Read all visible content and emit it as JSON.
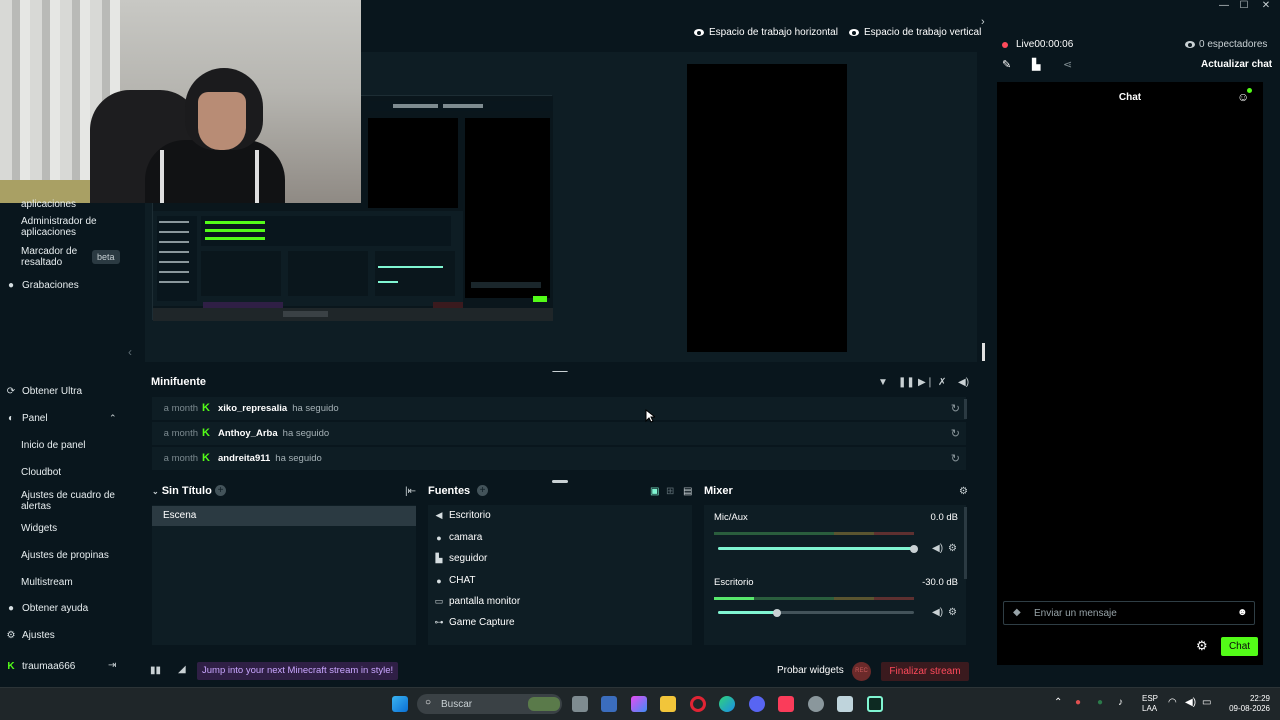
{
  "window": {
    "minimize": "—",
    "maximize": "☐",
    "close": "✕"
  },
  "top": {
    "workspace_h": "Espacio de trabajo horizontal",
    "workspace_v": "Espacio de trabajo vertical"
  },
  "sidebar": {
    "items": [
      {
        "label": "aplicaciones"
      },
      {
        "label": "Administrador de aplicaciones"
      },
      {
        "label": "Marcador de resaltado",
        "badge": "beta"
      },
      {
        "label": "Grabaciones"
      },
      {
        "label": "Obtener Ultra"
      },
      {
        "label": "Panel"
      },
      {
        "label": "Inicio de panel"
      },
      {
        "label": "Cloudbot"
      },
      {
        "label": "Ajustes de cuadro de alertas"
      },
      {
        "label": "Widgets"
      },
      {
        "label": "Ajustes de propinas"
      },
      {
        "label": "Multistream"
      },
      {
        "label": "Obtener ayuda"
      },
      {
        "label": "Ajustes"
      }
    ],
    "user": "traumaa666"
  },
  "minifuente": {
    "title": "Minifuente",
    "events": [
      {
        "time": "a month",
        "user": "xiko_represalia",
        "action": "ha seguido"
      },
      {
        "time": "a month",
        "user": "Anthoy_Arba",
        "action": "ha seguido"
      },
      {
        "time": "a month",
        "user": "andreita911",
        "action": "ha seguido"
      }
    ]
  },
  "scenes": {
    "title": "Sin Título",
    "items": [
      "Escena"
    ]
  },
  "sources": {
    "title": "Fuentes",
    "items": [
      {
        "label": "Escritorio",
        "icon": "speaker-icon"
      },
      {
        "label": "camara",
        "icon": "camera-icon"
      },
      {
        "label": "seguidor",
        "icon": "widget-icon"
      },
      {
        "label": "CHAT",
        "icon": "chat-icon"
      },
      {
        "label": "pantalla monitor",
        "icon": "monitor-icon"
      },
      {
        "label": "Game Capture",
        "icon": "gamepad-icon"
      }
    ]
  },
  "mixer": {
    "title": "Mixer",
    "channels": [
      {
        "name": "Mic/Aux",
        "db": "0.0 dB",
        "level": 1.0
      },
      {
        "name": "Escritorio",
        "db": "-30.0 dB",
        "level": 0.3
      }
    ]
  },
  "footer": {
    "promo": "Jump into your next Minecraft stream in style!",
    "test_widgets": "Probar widgets",
    "rec": "REC",
    "end_stream": "Finalizar stream"
  },
  "chat": {
    "live": "Live",
    "timer": "00:00:06",
    "viewers": "0 espectadores",
    "refresh": "Actualizar chat",
    "title": "Chat",
    "placeholder": "Enviar un mensaje",
    "send": "Chat"
  },
  "taskbar": {
    "search": "Buscar",
    "lang1": "ESP",
    "lang2": "LAA",
    "time": "22:29",
    "date": "09-08-2026"
  },
  "colors": {
    "accent": "#53fc18",
    "danger": "#ff4a5b",
    "mint": "#80f5d2"
  }
}
